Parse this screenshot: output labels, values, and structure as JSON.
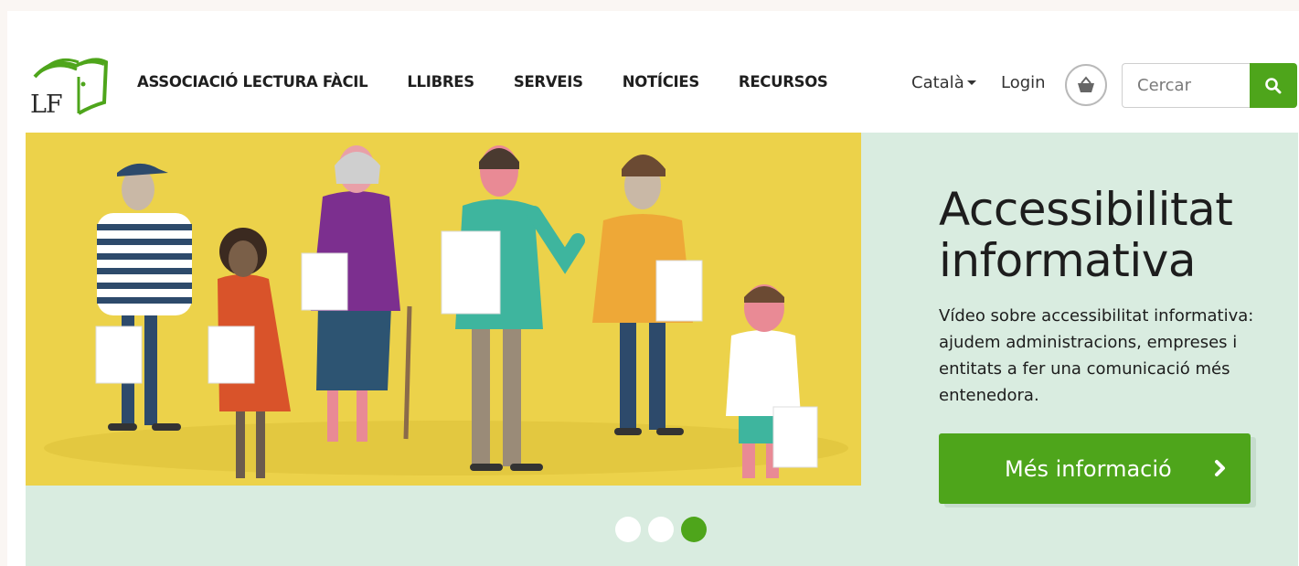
{
  "header": {
    "logo_text": "LF",
    "nav": [
      {
        "label": "ASSOCIACIÓ LECTURA FÀCIL"
      },
      {
        "label": "LLIBRES"
      },
      {
        "label": "SERVEIS"
      },
      {
        "label": "NOTÍCIES"
      },
      {
        "label": "RECURSOS"
      }
    ],
    "language": "Català",
    "login": "Login",
    "cart_icon": "shopping-basket-icon",
    "search": {
      "placeholder": "Cercar",
      "icon": "search-icon"
    }
  },
  "hero": {
    "title_line1": "Accessibilitat",
    "title_line2": "informativa",
    "description": "Vídeo sobre accessibilitat informativa: ajudem administracions, empreses i entitats a fer una comunicació més entenedora.",
    "button_label": "Més informació",
    "button_icon": "chevron-right-icon",
    "illustration": "people-holding-documents-illustration",
    "slides": {
      "count": 3,
      "active": 3
    }
  },
  "colors": {
    "brand_green": "#4ea51b",
    "hero_bg": "#d9ece0",
    "illustration_bg": "#ecd24a"
  }
}
